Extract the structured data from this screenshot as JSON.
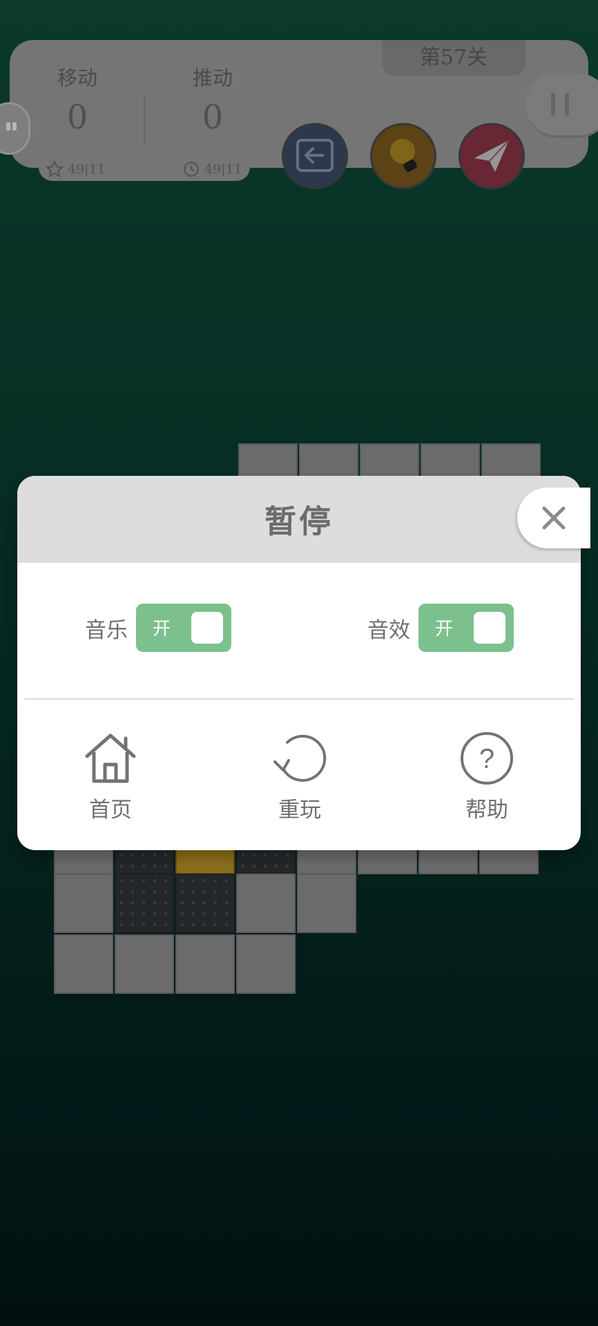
{
  "hud": {
    "level": "第57关",
    "moves_label": "移动",
    "moves_value": "0",
    "pushes_label": "推动",
    "pushes_value": "0",
    "moves_best": "49|11",
    "pushes_best": "49|11"
  },
  "dialog": {
    "title": "暂停",
    "music_label": "音乐",
    "music_toggle": "开",
    "sound_label": "音效",
    "sound_toggle": "开",
    "home_label": "首页",
    "replay_label": "重玩",
    "help_label": "帮助"
  },
  "colors": {
    "toggle_on": "#7cc08e",
    "background_top": "#0f4d3b",
    "background_bottom": "#021616"
  },
  "icons": [
    "close-icon",
    "home-icon",
    "replay-icon",
    "help-icon",
    "back-icon",
    "hint-bulb-icon",
    "paper-plane-icon",
    "pause-icon",
    "star-icon",
    "clock-icon"
  ]
}
